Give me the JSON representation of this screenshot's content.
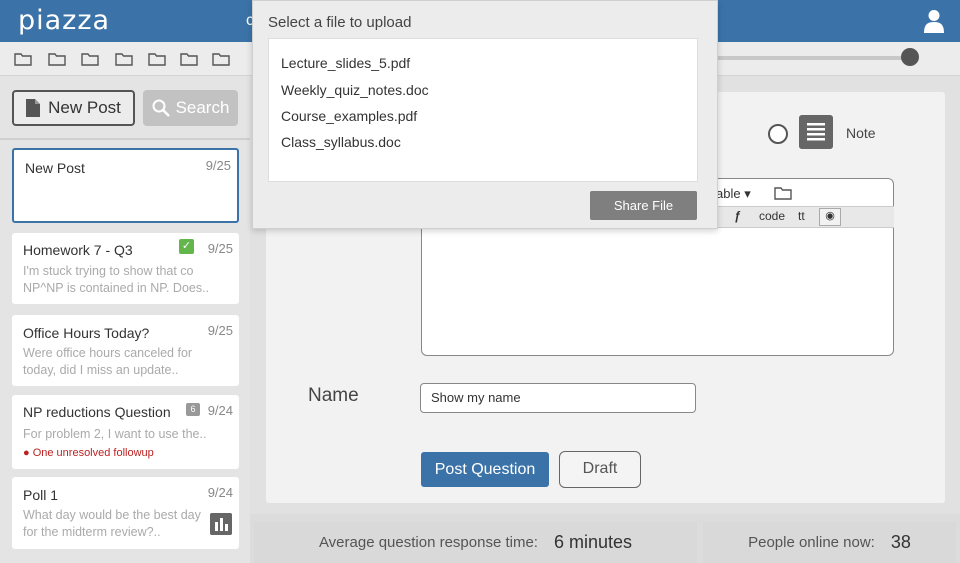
{
  "app": {
    "logo": "piazza",
    "top_partial": "c"
  },
  "toolbar": {
    "folders": [
      "folder-icon",
      "folder-icon",
      "folder-icon",
      "folder-icon",
      "folder-icon",
      "folder-icon",
      "folder-icon"
    ]
  },
  "sidebar": {
    "new_post_label": "New Post",
    "search_label": "Search",
    "posts": [
      {
        "title": "New Post",
        "date": "9/25",
        "body": ""
      },
      {
        "title": "Homework 7 - Q3",
        "date": "9/25",
        "body": "I'm stuck trying to show that co NP^NP is contained in NP.  Does..",
        "resolved": true
      },
      {
        "title": "Office Hours Today?",
        "date": "9/25",
        "body": "Were office hours canceled for today, did I miss an update.."
      },
      {
        "title": "NP reductions Question",
        "date": "9/24",
        "badge": "6",
        "body": "For problem 2, I want to use the..",
        "flag": "One unresolved followup"
      },
      {
        "title": "Poll 1",
        "date": "9/24",
        "body": "What day would be the best day for the midterm review?.."
      }
    ]
  },
  "upload_dialog": {
    "title": "Select a file to upload",
    "files": [
      "Lecture_slides_5.pdf",
      "Weekly_quiz_notes.doc",
      "Course_examples.pdf",
      "Class_syllabus.doc"
    ],
    "share_label": "Share File"
  },
  "compose": {
    "note_label": "Note",
    "editor_toolbar": {
      "table_label": "able",
      "code_label": "code",
      "tt_label": "tt"
    },
    "name_label": "Name",
    "name_value": "Show my name",
    "post_label": "Post Question",
    "draft_label": "Draft"
  },
  "footer": {
    "response_label": "Average question response time:",
    "response_value": "6 minutes",
    "online_label": "People online now:",
    "online_value": "38"
  },
  "colors": {
    "brand": "#3b73a8",
    "resolved": "#64b64c",
    "warning": "#b22222"
  }
}
